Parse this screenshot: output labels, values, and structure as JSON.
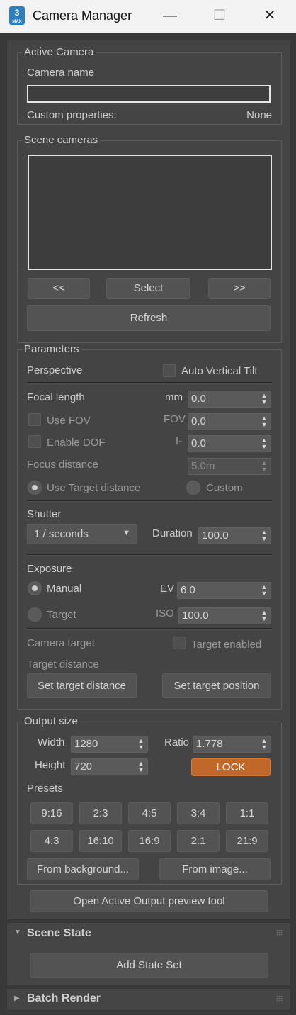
{
  "window": {
    "title": "Camera Manager",
    "icon_text": "3",
    "icon_subtext": "MAX",
    "minimize_glyph": "—",
    "maximize_glyph": "☐",
    "close_glyph": "✕"
  },
  "active_camera": {
    "legend": "Active Camera",
    "name_label": "Camera name",
    "name_value": "",
    "custom_props_label": "Custom properties:",
    "custom_props_value": "None"
  },
  "scene_cameras": {
    "legend": "Scene cameras",
    "items": [],
    "prev_label": "<<",
    "select_label": "Select",
    "next_label": ">>",
    "refresh_label": "Refresh"
  },
  "parameters": {
    "legend": "Parameters",
    "perspective_label": "Perspective",
    "auto_vertical_tilt_label": "Auto Vertical Tilt",
    "focal_length_label": "Focal length",
    "focal_length_unit": "mm",
    "focal_length_value": "0.0",
    "use_fov_label": "Use FOV",
    "fov_label": "FOV",
    "fov_value": "0.0",
    "enable_dof_label": "Enable DOF",
    "f_label": "f-",
    "f_value": "0.0",
    "focus_distance_label": "Focus distance",
    "focus_distance_value": "5.0m",
    "use_target_distance_label": "Use Target distance",
    "custom_label": "Custom",
    "shutter_label": "Shutter",
    "shutter_mode": "1 / seconds",
    "duration_label": "Duration",
    "duration_value": "100.0",
    "exposure_label": "Exposure",
    "manual_label": "Manual",
    "ev_label": "EV",
    "ev_value": "6.0",
    "target_label": "Target",
    "iso_label": "ISO",
    "iso_value": "100.0",
    "camera_target_label": "Camera target",
    "target_enabled_label": "Target enabled",
    "target_distance_label": "Target distance",
    "set_target_distance_label": "Set target distance",
    "set_target_position_label": "Set target position"
  },
  "output_size": {
    "legend": "Output size",
    "width_label": "Width",
    "width_value": "1280",
    "ratio_label": "Ratio",
    "ratio_value": "1.778",
    "height_label": "Height",
    "height_value": "720",
    "lock_label": "LOCK",
    "presets_label": "Presets",
    "presets": [
      "9:16",
      "2:3",
      "4:5",
      "3:4",
      "1:1",
      "4:3",
      "16:10",
      "16:9",
      "2:1",
      "21:9"
    ],
    "from_background_label": "From background...",
    "from_image_label": "From image..."
  },
  "open_preview_label": "Open Active Output preview tool",
  "scene_state": {
    "title": "Scene State",
    "add_state_set_label": "Add State Set"
  },
  "batch_render": {
    "title": "Batch Render"
  },
  "colors": {
    "accent_lock": "#c2672a",
    "background": "#444444",
    "titlebar": "#f3f3f3"
  }
}
